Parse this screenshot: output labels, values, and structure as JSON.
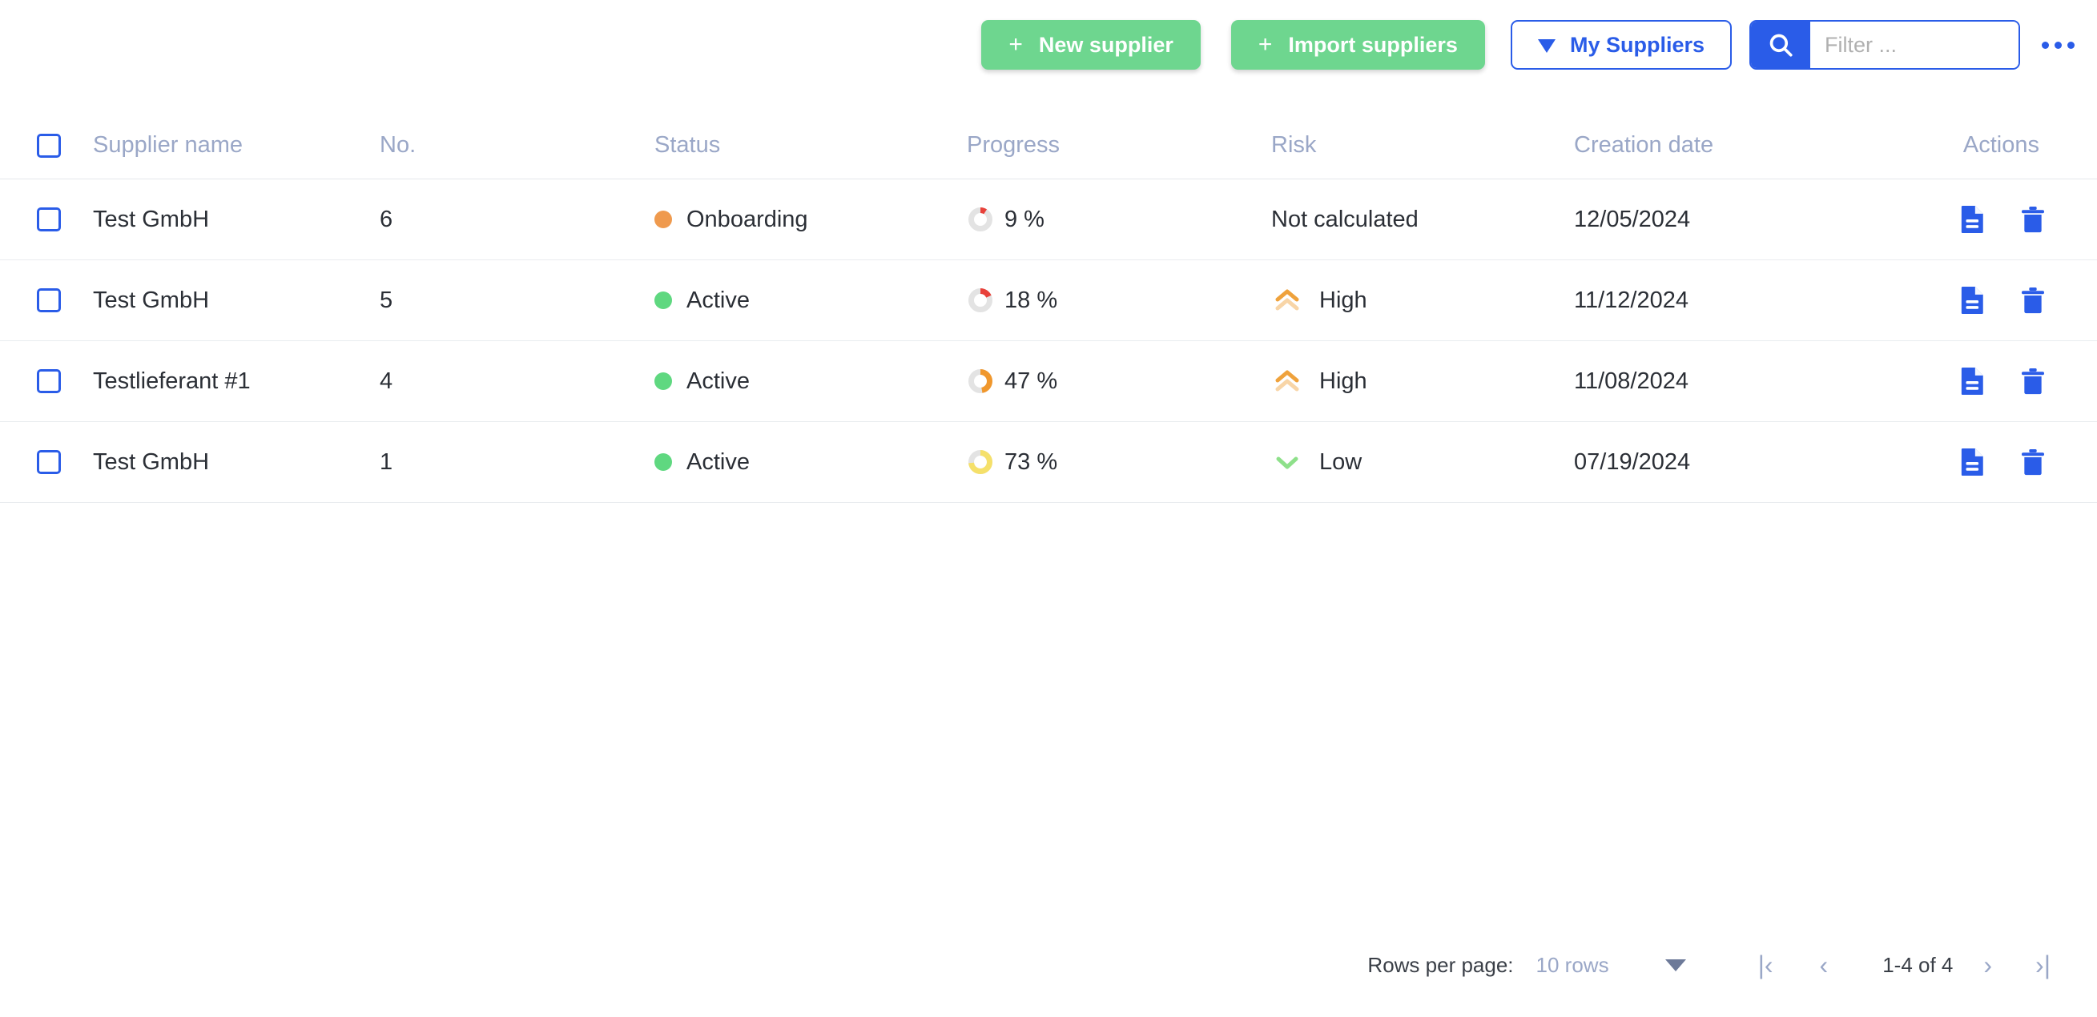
{
  "toolbar": {
    "new_supplier": "New supplier",
    "import_suppliers": "Import suppliers",
    "my_suppliers": "My Suppliers",
    "plus_glyph": "+",
    "search_placeholder": "Filter ..."
  },
  "colors": {
    "green": "#6ed68f",
    "blue": "#2a5ce8",
    "header_text": "#9aa7c7",
    "status_active": "#5fd880",
    "status_onboarding": "#ef9a4e",
    "risk_high": "#efa23c",
    "risk_low": "#8ee08a",
    "progress_red": "#e8413a",
    "progress_orange": "#f0972c",
    "progress_yellow": "#f5e06a",
    "progress_track": "#e3e3e3"
  },
  "table": {
    "columns": [
      "Supplier name",
      "No.",
      "Status",
      "Progress",
      "Risk",
      "Creation date",
      "Actions"
    ],
    "rows": [
      {
        "name": "Test GmbH",
        "no": "6",
        "status": "Onboarding",
        "status_color": "#ef9a4e",
        "progress": "9 %",
        "progress_value": 9,
        "progress_color": "#e8413a",
        "risk": "Not calculated",
        "risk_level": "none",
        "date": "12/05/2024"
      },
      {
        "name": "Test GmbH",
        "no": "5",
        "status": "Active",
        "status_color": "#5fd880",
        "progress": "18 %",
        "progress_value": 18,
        "progress_color": "#e8413a",
        "risk": "High",
        "risk_level": "high",
        "date": "11/12/2024"
      },
      {
        "name": "Testlieferant #1",
        "no": "4",
        "status": "Active",
        "status_color": "#5fd880",
        "progress": "47 %",
        "progress_value": 47,
        "progress_color": "#f0972c",
        "risk": "High",
        "risk_level": "high",
        "date": "11/08/2024"
      },
      {
        "name": "Test GmbH",
        "no": "1",
        "status": "Active",
        "status_color": "#5fd880",
        "progress": "73 %",
        "progress_value": 73,
        "progress_color": "#f5e06a",
        "risk": "Low",
        "risk_level": "low",
        "date": "07/19/2024"
      }
    ]
  },
  "footer": {
    "rows_per_page_label": "Rows per page:",
    "rows_per_page_value": "10 rows",
    "range": "1-4 of 4",
    "first_glyph": "|‹",
    "prev_glyph": "‹",
    "next_glyph": "›",
    "last_glyph": "›|"
  }
}
